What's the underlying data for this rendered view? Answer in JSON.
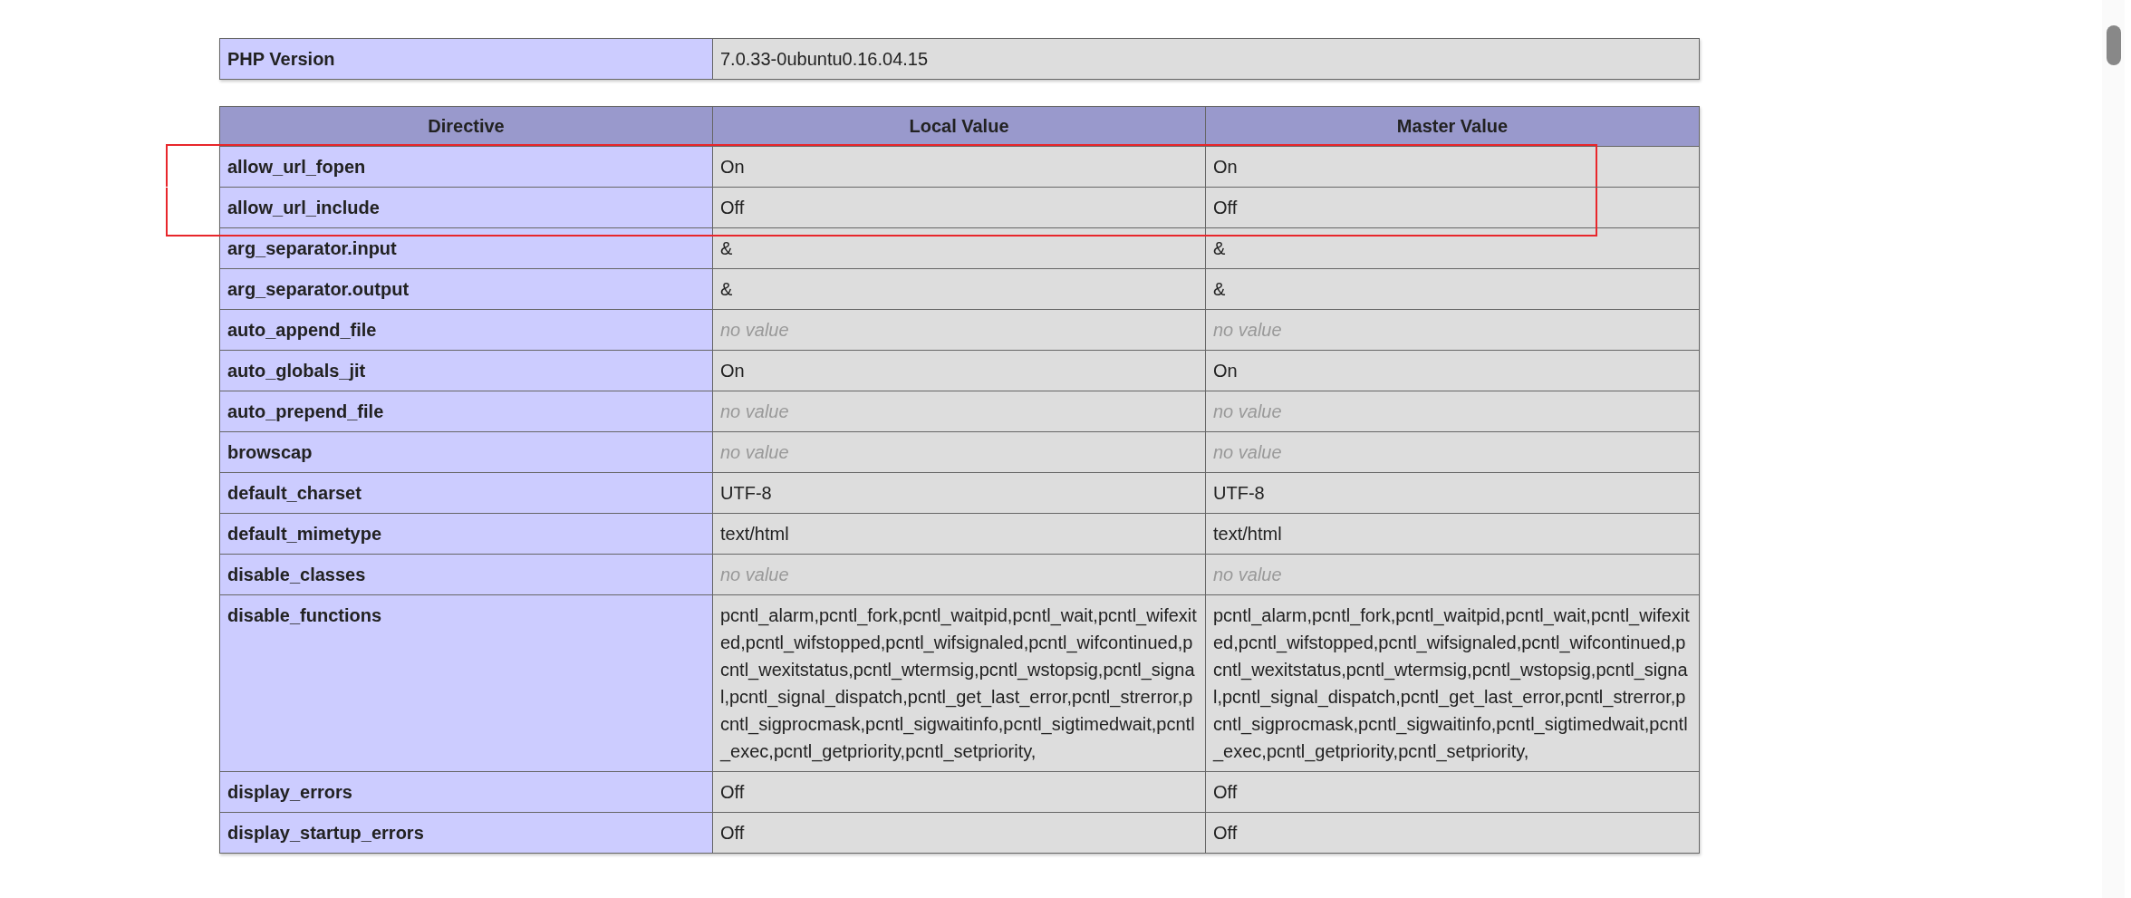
{
  "version_table": {
    "label": "PHP Version",
    "value": "7.0.33-0ubuntu0.16.04.15"
  },
  "directives_table": {
    "columns": [
      "Directive",
      "Local Value",
      "Master Value"
    ],
    "rows": [
      {
        "directive": "allow_url_fopen",
        "boxed": true,
        "local": {
          "text": "On",
          "kind": "value"
        },
        "master": {
          "text": "On",
          "kind": "value"
        }
      },
      {
        "directive": "allow_url_include",
        "boxed": true,
        "local": {
          "text": "Off",
          "kind": "value"
        },
        "master": {
          "text": "Off",
          "kind": "value"
        }
      },
      {
        "directive": "arg_separator.input",
        "boxed": false,
        "local": {
          "text": "&",
          "kind": "value"
        },
        "master": {
          "text": "&",
          "kind": "value"
        }
      },
      {
        "directive": "arg_separator.output",
        "boxed": false,
        "local": {
          "text": "&",
          "kind": "value"
        },
        "master": {
          "text": "&",
          "kind": "value"
        }
      },
      {
        "directive": "auto_append_file",
        "boxed": false,
        "local": {
          "text": "no value",
          "kind": "no_value"
        },
        "master": {
          "text": "no value",
          "kind": "no_value"
        }
      },
      {
        "directive": "auto_globals_jit",
        "boxed": false,
        "local": {
          "text": "On",
          "kind": "value"
        },
        "master": {
          "text": "On",
          "kind": "value"
        }
      },
      {
        "directive": "auto_prepend_file",
        "boxed": false,
        "local": {
          "text": "no value",
          "kind": "no_value"
        },
        "master": {
          "text": "no value",
          "kind": "no_value"
        }
      },
      {
        "directive": "browscap",
        "boxed": false,
        "local": {
          "text": "no value",
          "kind": "no_value"
        },
        "master": {
          "text": "no value",
          "kind": "no_value"
        }
      },
      {
        "directive": "default_charset",
        "boxed": false,
        "local": {
          "text": "UTF-8",
          "kind": "value"
        },
        "master": {
          "text": "UTF-8",
          "kind": "value"
        }
      },
      {
        "directive": "default_mimetype",
        "boxed": false,
        "local": {
          "text": "text/html",
          "kind": "value"
        },
        "master": {
          "text": "text/html",
          "kind": "value"
        }
      },
      {
        "directive": "disable_classes",
        "boxed": false,
        "local": {
          "text": "no value",
          "kind": "no_value"
        },
        "master": {
          "text": "no value",
          "kind": "no_value"
        }
      },
      {
        "directive": "disable_functions",
        "boxed": false,
        "local": {
          "text": "pcntl_alarm,pcntl_fork,pcntl_waitpid,pcntl_wait,pcntl_wifexited,pcntl_wifstopped,pcntl_wifsignaled,pcntl_wifcontinued,pcntl_wexitstatus,pcntl_wtermsig,pcntl_wstopsig,pcntl_signal,pcntl_signal_dispatch,pcntl_get_last_error,pcntl_strerror,pcntl_sigprocmask,pcntl_sigwaitinfo,pcntl_sigtimedwait,pcntl_exec,pcntl_getpriority,pcntl_setpriority,",
          "kind": "value"
        },
        "master": {
          "text": "pcntl_alarm,pcntl_fork,pcntl_waitpid,pcntl_wait,pcntl_wifexited,pcntl_wifstopped,pcntl_wifsignaled,pcntl_wifcontinued,pcntl_wexitstatus,pcntl_wtermsig,pcntl_wstopsig,pcntl_signal,pcntl_signal_dispatch,pcntl_get_last_error,pcntl_strerror,pcntl_sigprocmask,pcntl_sigwaitinfo,pcntl_sigtimedwait,pcntl_exec,pcntl_getpriority,pcntl_setpriority,",
          "kind": "value"
        }
      },
      {
        "directive": "display_errors",
        "boxed": false,
        "local": {
          "text": "Off",
          "kind": "value"
        },
        "master": {
          "text": "Off",
          "kind": "value"
        }
      },
      {
        "directive": "display_startup_errors",
        "boxed": false,
        "local": {
          "text": "Off",
          "kind": "value"
        },
        "master": {
          "text": "Off",
          "kind": "value"
        }
      }
    ]
  }
}
